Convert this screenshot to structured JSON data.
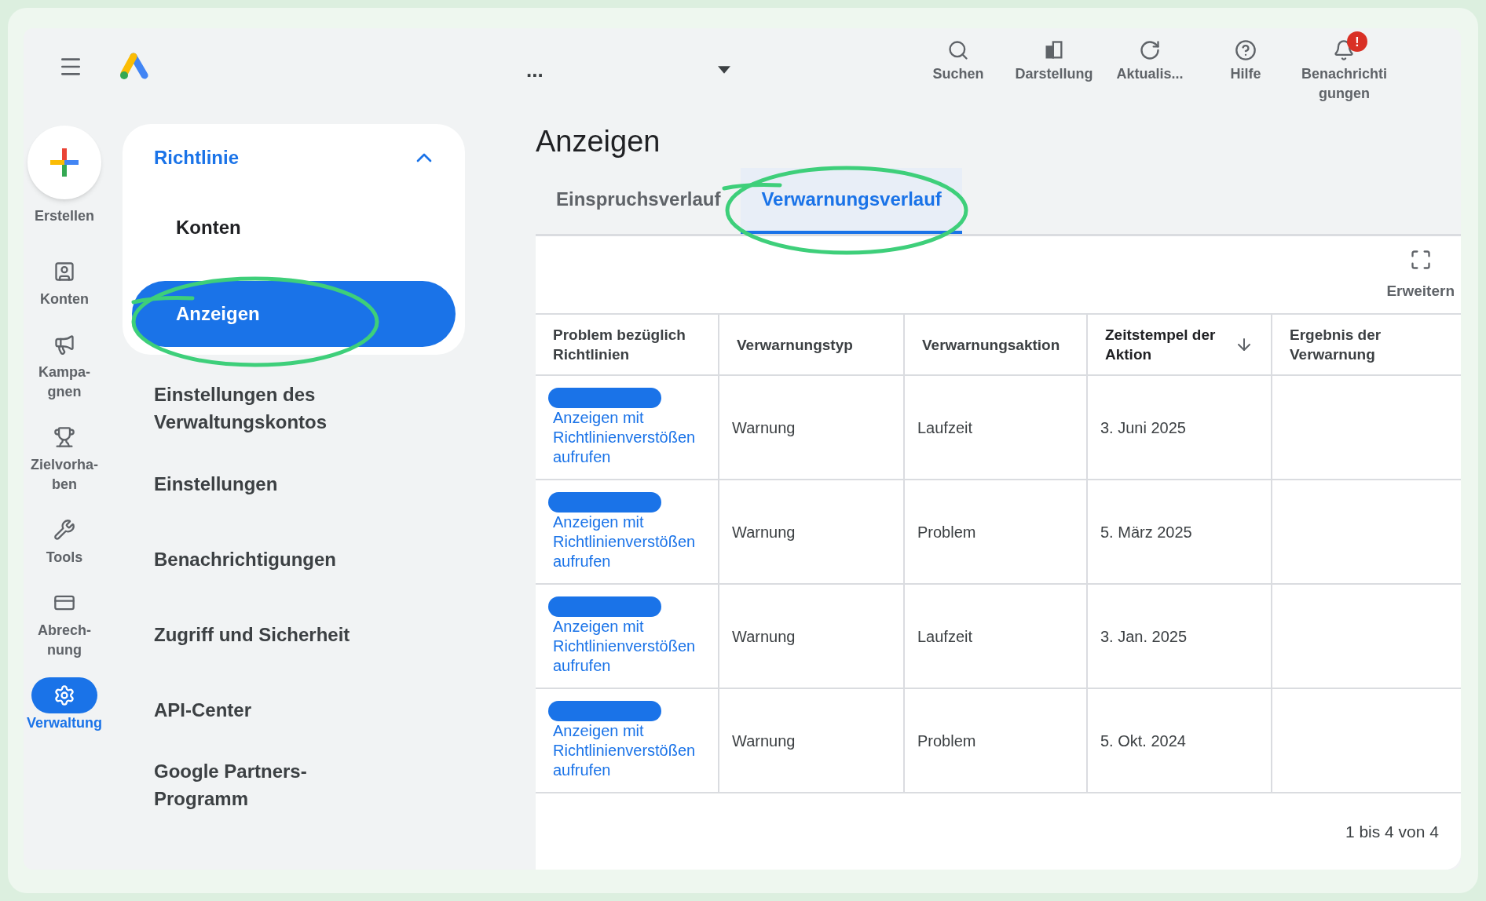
{
  "topbar": {
    "account": "...",
    "actions": [
      {
        "kind": "search",
        "label": "Suchen"
      },
      {
        "kind": "appearance",
        "label": "Darstellung"
      },
      {
        "kind": "refresh",
        "label": "Aktualis..."
      },
      {
        "kind": "help",
        "label": "Hilfe"
      },
      {
        "kind": "notifications",
        "label": "Benachrichti\ngungen",
        "badge": "!"
      }
    ]
  },
  "rail": {
    "create": {
      "label": "Erstellen"
    },
    "items": [
      {
        "kind": "accounts",
        "label": "Konten",
        "selected": false
      },
      {
        "kind": "campaigns",
        "label": "Kampa-\ngnen",
        "selected": false
      },
      {
        "kind": "goals",
        "label": "Zielvorha-\nben",
        "selected": false
      },
      {
        "kind": "tools",
        "label": "Tools",
        "selected": false
      },
      {
        "kind": "billing",
        "label": "Abrech-\nnung",
        "selected": false
      },
      {
        "kind": "admin",
        "label": "Verwaltung",
        "selected": true
      }
    ]
  },
  "nav": {
    "section": {
      "label": "Richtlinie",
      "expanded": true,
      "children": [
        {
          "label": "Konten",
          "selected": false
        },
        {
          "label": "Anzeigen",
          "selected": true
        }
      ]
    },
    "items": [
      "Einstellungen des Verwaltungskontos",
      "Einstellungen",
      "Benachrichtigungen",
      "Zugriff und Sicherheit",
      "API-Center",
      "Google Partners-Programm"
    ]
  },
  "page": {
    "title": "Anzeigen",
    "tabs": [
      {
        "label": "Einspruchsverlauf",
        "selected": false
      },
      {
        "label": "Verwarnungsverlauf",
        "selected": true
      }
    ],
    "expand": "Erweitern",
    "table": {
      "columns": [
        {
          "label": "Problem bezüglich Richtlinien",
          "sorted": false
        },
        {
          "label": "Verwarnungstyp",
          "sorted": false
        },
        {
          "label": "Verwarnungsaktion",
          "sorted": false
        },
        {
          "label": "Zeitstempel der Aktion",
          "sorted": true
        },
        {
          "label": "Ergebnis der Verwarnung",
          "sorted": false
        }
      ],
      "rows": [
        {
          "link": "Anzeigen mit Richtlinienverstößen aufrufen",
          "type": "Warnung",
          "action": "Laufzeit",
          "timestamp": "3. Juni 2025"
        },
        {
          "link": "Anzeigen mit Richtlinienverstößen aufrufen",
          "type": "Warnung",
          "action": "Problem",
          "timestamp": "5. März 2025"
        },
        {
          "link": "Anzeigen mit Richtlinienverstößen aufrufen",
          "type": "Warnung",
          "action": "Laufzeit",
          "timestamp": "3. Jan. 2025"
        },
        {
          "link": "Anzeigen mit Richtlinienverstößen aufrufen",
          "type": "Warnung",
          "action": "Problem",
          "timestamp": "5. Okt. 2024"
        }
      ]
    },
    "pagination": "1 bis 4 von 4"
  }
}
